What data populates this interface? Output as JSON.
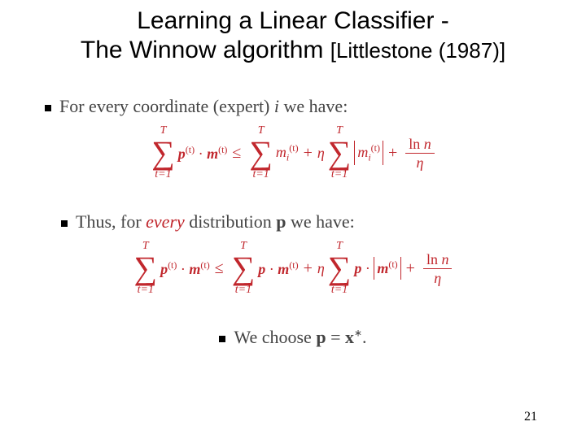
{
  "title": {
    "line1": "Learning a Linear Classifier -",
    "line2_main": "The Winnow algorithm ",
    "citation": "[Littlestone (1987)]"
  },
  "intro1": {
    "prefix": "For every coordinate (expert) ",
    "var": "i",
    "suffix": " we have:"
  },
  "intro2": {
    "prefix": "Thus, for ",
    "every": "every",
    "mid": " distribution ",
    "var": "p",
    "suffix": " we have:"
  },
  "intro3": {
    "prefix": "We choose ",
    "eq_lhs": "p",
    "eq_op": " = ",
    "eq_rhs": "x",
    "eq_star": "∗",
    "suffix": "."
  },
  "eq1": {
    "sum_top": "T",
    "sum_bot": "t=1",
    "lhs_p": "p",
    "lhs_sup": "(t)",
    "dot": "·",
    "lhs_m": "m",
    "le": "≤",
    "rhs1_m": "m",
    "rhs1_sub": "i",
    "rhs1_sup": "(t)",
    "plus": "+",
    "eta": "η",
    "abs_m": "m",
    "abs_sub": "i",
    "abs_sup": "(t)",
    "frac_num_a": "ln ",
    "frac_num_b": "n",
    "frac_den": "η"
  },
  "eq2": {
    "sum_top": "T",
    "sum_bot": "t=1",
    "lhs_p": "p",
    "lhs_sup": "(t)",
    "dot": "·",
    "lhs_m": "m",
    "le": "≤",
    "rhs1_p": "p",
    "rhs1_m": "m",
    "rhs1_sup": "(t)",
    "plus": "+",
    "eta": "η",
    "abs_m": "m",
    "abs_sup": "(t)",
    "frac_num_a": "ln ",
    "frac_num_b": "n",
    "frac_den": "η"
  },
  "page_number": "21"
}
